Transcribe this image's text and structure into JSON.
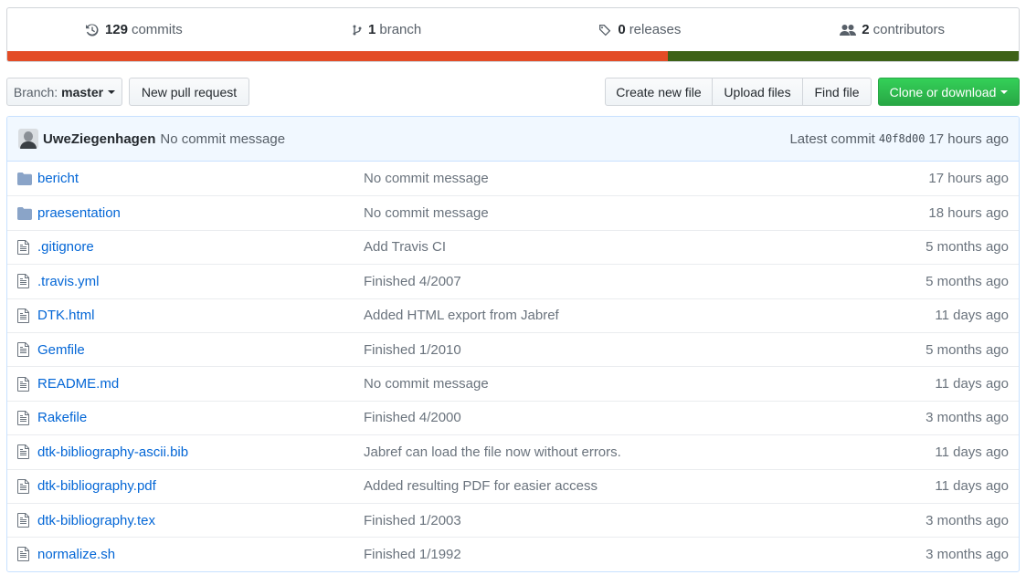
{
  "summary": {
    "commits": {
      "count": "129",
      "label": "commits",
      "icon": "history-icon"
    },
    "branches": {
      "count": "1",
      "label": "branch",
      "icon": "branch-icon"
    },
    "releases": {
      "count": "0",
      "label": "releases",
      "icon": "tag-icon"
    },
    "contributors": {
      "count": "2",
      "label": "contributors",
      "icon": "people-icon"
    }
  },
  "language_bar": [
    {
      "color": "#e34c26",
      "fraction": 0.653
    },
    {
      "color": "#3d6117",
      "fraction": 0.347
    }
  ],
  "toolbar": {
    "branch_prefix": "Branch:",
    "branch_name": "master",
    "new_pr": "New pull request",
    "create_file": "Create new file",
    "upload_files": "Upload files",
    "find_file": "Find file",
    "clone": "Clone or download"
  },
  "latest_commit": {
    "author": "UweZiegenhagen",
    "message": "No commit message",
    "label": "Latest commit",
    "sha": "40f8d00",
    "age": "17 hours ago"
  },
  "files": [
    {
      "type": "folder",
      "name": "bericht",
      "message": "No commit message",
      "age": "17 hours ago"
    },
    {
      "type": "folder",
      "name": "praesentation",
      "message": "No commit message",
      "age": "18 hours ago"
    },
    {
      "type": "file",
      "name": ".gitignore",
      "message": "Add Travis CI",
      "age": "5 months ago"
    },
    {
      "type": "file",
      "name": ".travis.yml",
      "message": "Finished 4/2007",
      "age": "5 months ago"
    },
    {
      "type": "file",
      "name": "DTK.html",
      "message": "Added HTML export from Jabref",
      "age": "11 days ago"
    },
    {
      "type": "file",
      "name": "Gemfile",
      "message": "Finished 1/2010",
      "age": "5 months ago"
    },
    {
      "type": "file",
      "name": "README.md",
      "message": "No commit message",
      "age": "11 days ago"
    },
    {
      "type": "file",
      "name": "Rakefile",
      "message": "Finished 4/2000",
      "age": "3 months ago"
    },
    {
      "type": "file",
      "name": "dtk-bibliography-ascii.bib",
      "message": "Jabref can load the file now without errors.",
      "age": "11 days ago"
    },
    {
      "type": "file",
      "name": "dtk-bibliography.pdf",
      "message": "Added resulting PDF for easier access",
      "age": "11 days ago"
    },
    {
      "type": "file",
      "name": "dtk-bibliography.tex",
      "message": "Finished 1/2003",
      "age": "3 months ago"
    },
    {
      "type": "file",
      "name": "normalize.sh",
      "message": "Finished 1/1992",
      "age": "3 months ago"
    }
  ]
}
